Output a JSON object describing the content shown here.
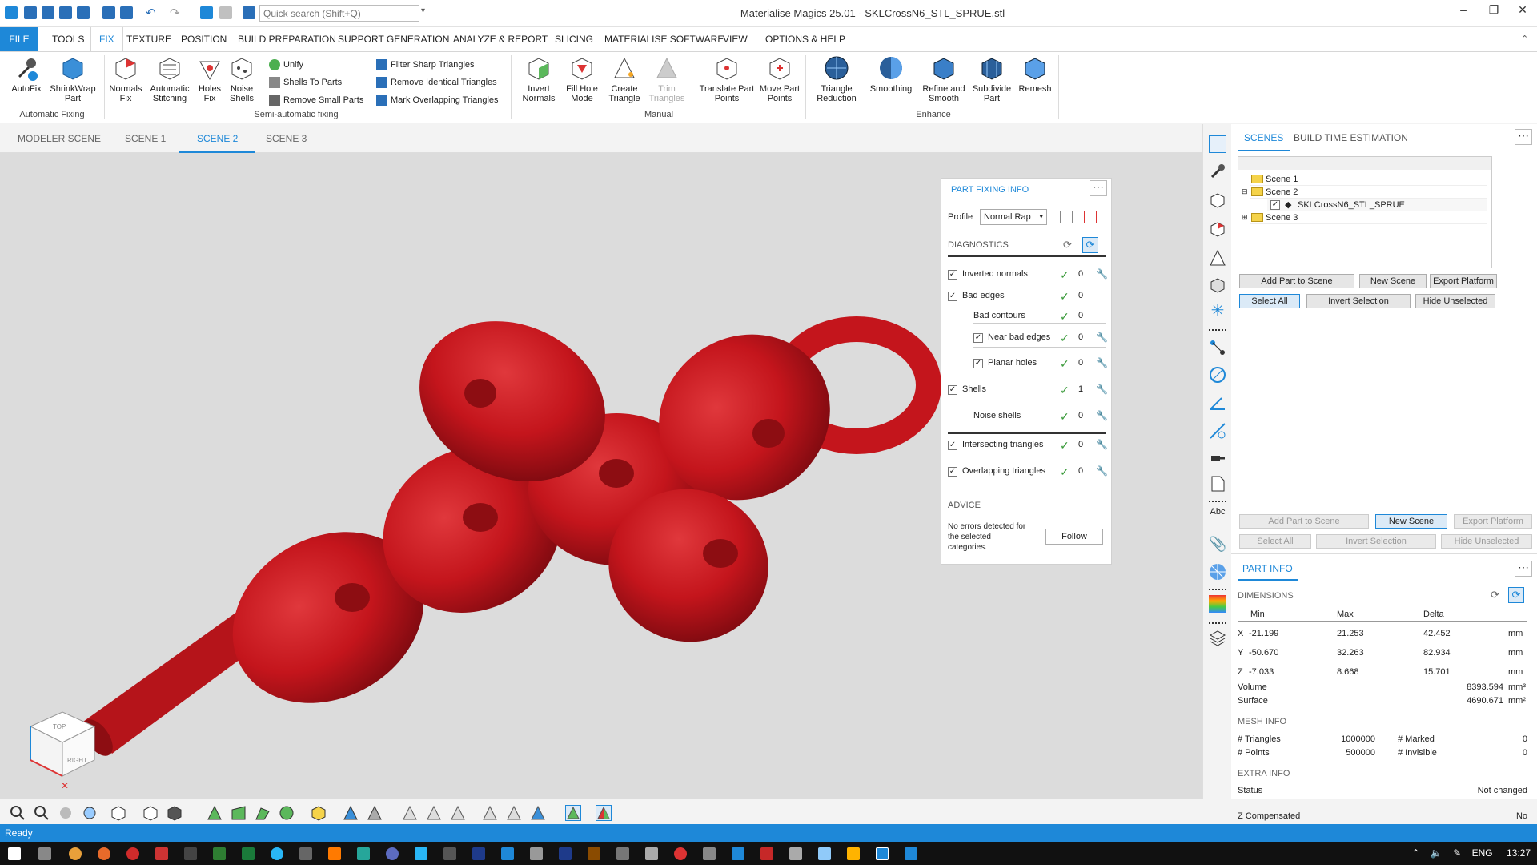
{
  "app": {
    "title": "Materialise Magics 25.01 - SKLCrossN6_STL_SPRUE.stl"
  },
  "quickaccess": {
    "search_placeholder": "Quick search (Shift+Q)"
  },
  "menu": {
    "tabs": [
      "FILE",
      "TOOLS",
      "FIX",
      "TEXTURE",
      "POSITION",
      "BUILD PREPARATION",
      "SUPPORT GENERATION",
      "ANALYZE & REPORT",
      "SLICING",
      "MATERIALISE SOFTWARE",
      "VIEW",
      "OPTIONS & HELP"
    ]
  },
  "ribbon": {
    "automatic": {
      "label": "Automatic Fixing",
      "autofix": "AutoFix",
      "shrinkwrap1": "ShrinkWrap",
      "shrinkwrap2": "Part"
    },
    "semi": {
      "label": "Semi-automatic fixing",
      "normals1": "Normals",
      "normals2": "Fix",
      "stitch1": "Automatic",
      "stitch2": "Stitching",
      "holes1": "Holes",
      "holes2": "Fix",
      "noise1": "Noise",
      "noise2": "Shells",
      "unify": "Unify",
      "shells_to_parts": "Shells To Parts",
      "remove_small": "Remove Small Parts",
      "filter_sharp": "Filter Sharp Triangles",
      "remove_identical": "Remove Identical Triangles",
      "mark_overlapping": "Mark Overlapping Triangles"
    },
    "manual": {
      "label": "Manual",
      "invert1": "Invert",
      "invert2": "Normals",
      "fillhole1": "Fill Hole",
      "fillhole2": "Mode",
      "create1": "Create",
      "create2": "Triangle",
      "trim1": "Trim",
      "trim2": "Triangles",
      "translate1": "Translate Part",
      "translate2": "Points",
      "move1": "Move Part",
      "move2": "Points"
    },
    "enhance": {
      "label": "Enhance",
      "reduction1": "Triangle",
      "reduction2": "Reduction",
      "smoothing": "Smoothing",
      "refine1": "Refine and",
      "refine2": "Smooth",
      "subdivide1": "Subdivide",
      "subdivide2": "Part",
      "remesh": "Remesh"
    }
  },
  "scenes": {
    "tabs": [
      "MODELER SCENE",
      "SCENE 1",
      "SCENE 2",
      "SCENE 3"
    ],
    "active": "SCENE 2"
  },
  "part_fixing": {
    "title": "PART FIXING INFO",
    "profile_label": "Profile",
    "profile_value": "Normal Rap",
    "diagnostics_label": "DIAGNOSTICS",
    "rows": [
      {
        "label": "Inverted normals",
        "count": "0"
      },
      {
        "label": "Bad edges",
        "count": "0"
      },
      {
        "label": "Bad contours",
        "count": "0"
      },
      {
        "label": "Near bad edges",
        "count": "0"
      },
      {
        "label": "Planar holes",
        "count": "0"
      },
      {
        "label": "Shells",
        "count": "1"
      },
      {
        "label": "Noise shells",
        "count": "0"
      },
      {
        "label": "Intersecting triangles",
        "count": "0"
      },
      {
        "label": "Overlapping triangles",
        "count": "0"
      }
    ],
    "advice_label": "ADVICE",
    "advice_text1": "No errors detected for",
    "advice_text2": "the selected",
    "advice_text3": "categories.",
    "follow": "Follow"
  },
  "right_panel": {
    "tabs": [
      "SCENES",
      "BUILD TIME ESTIMATION"
    ],
    "tree": [
      "Scene 1",
      "Scene 2",
      "SKLCrossN6_STL_SPRUE",
      "Scene 3"
    ],
    "buttons_top": [
      "Add Part to Scene",
      "New Scene",
      "Export Platform",
      "Select All",
      "Invert Selection",
      "Hide Unselected"
    ],
    "buttons_bottom": [
      "Add Part to Scene",
      "New Scene",
      "Export Platform",
      "Select All",
      "Invert Selection",
      "Hide Unselected"
    ],
    "part_info_title": "PART INFO",
    "dimensions_label": "DIMENSIONS",
    "dim_headers": [
      "Min",
      "Max",
      "Delta"
    ],
    "dims": [
      {
        "axis": "X",
        "min": "-21.199",
        "max": "21.253",
        "delta": "42.452",
        "unit": "mm"
      },
      {
        "axis": "Y",
        "min": "-50.670",
        "max": "32.263",
        "delta": "82.934",
        "unit": "mm"
      },
      {
        "axis": "Z",
        "min": "-7.033",
        "max": "8.668",
        "delta": "15.701",
        "unit": "mm"
      }
    ],
    "volume_label": "Volume",
    "volume_value": "8393.594",
    "volume_unit": "mm³",
    "surface_label": "Surface",
    "surface_value": "4690.671",
    "surface_unit": "mm²",
    "mesh_label": "MESH INFO",
    "triangles_label": "# Triangles",
    "triangles_value": "1000000",
    "marked_label": "# Marked",
    "marked_value": "0",
    "points_label": "# Points",
    "points_value": "500000",
    "invisible_label": "# Invisible",
    "invisible_value": "0",
    "extra_label": "EXTRA INFO",
    "status_label": "Status",
    "status_value": "Not changed",
    "zcomp_label": "Z Compensated",
    "zcomp_value": "No"
  },
  "viewcube": {
    "top": "TOP",
    "right": "RIGHT"
  },
  "status": {
    "text": "Ready"
  },
  "taskbar": {
    "lang": "ENG",
    "time": "13:27"
  },
  "colors": {
    "accent": "#1e88d8",
    "model": "#c4151c",
    "viewport": "#dcdcdc"
  }
}
